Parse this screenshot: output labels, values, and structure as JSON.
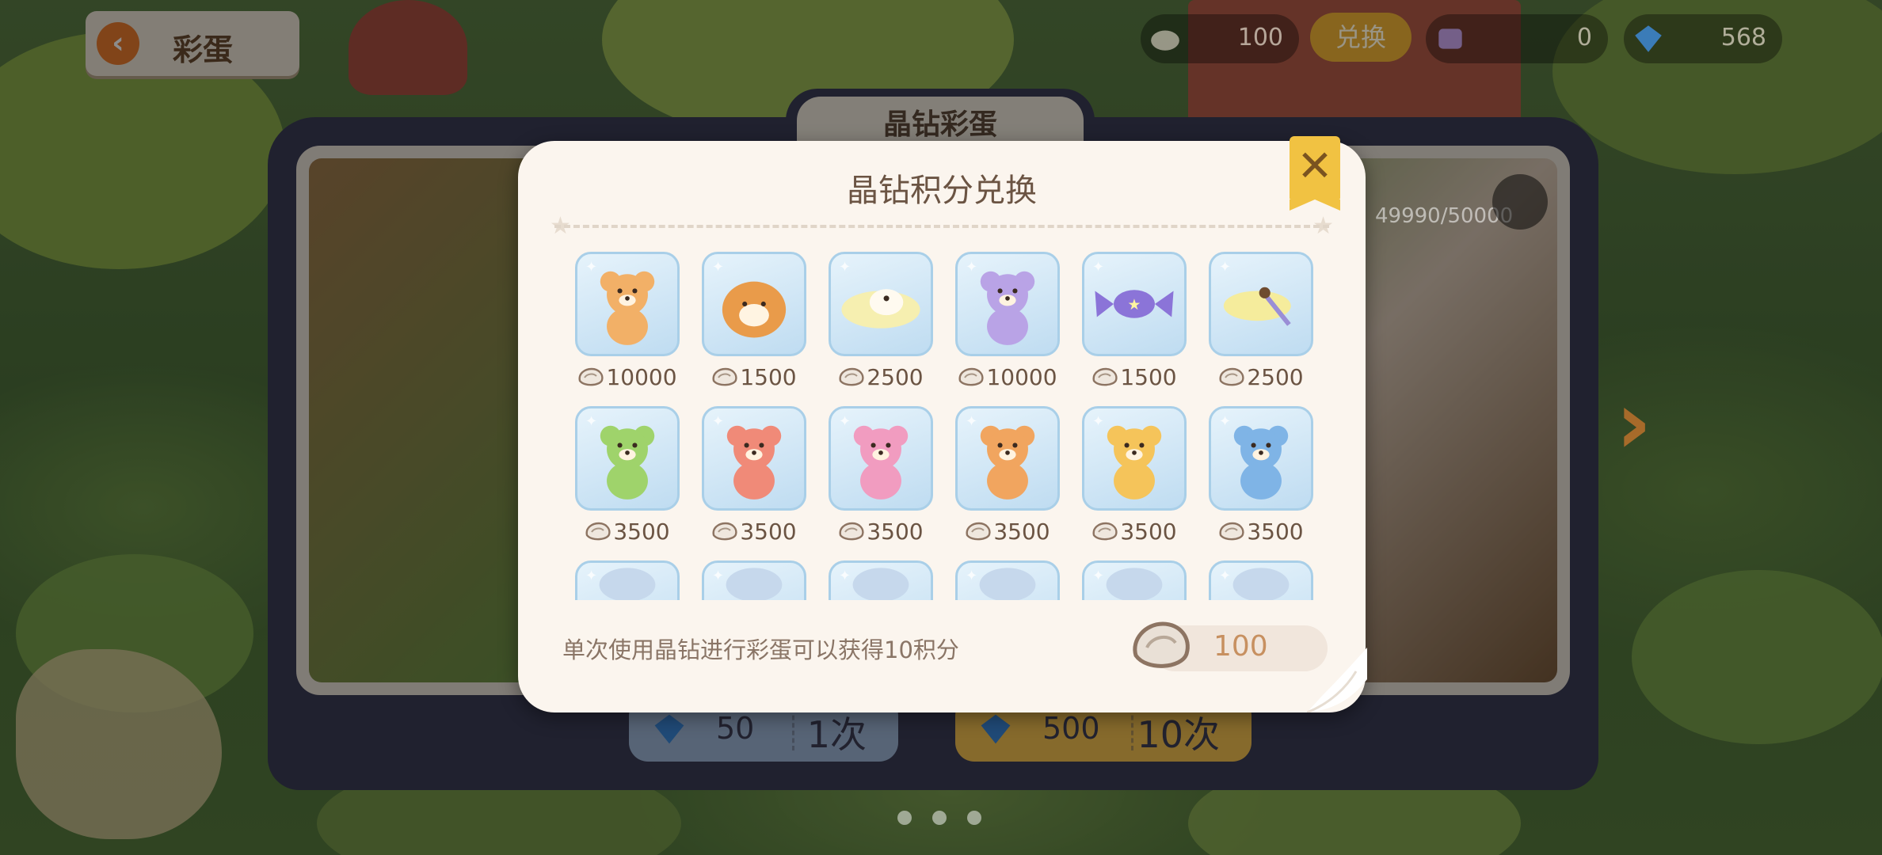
{
  "colors": {
    "modal_bg": "#fbf5ee",
    "tile_bg": "#cfe6f6",
    "accent_orange": "#ea7b2e",
    "accent_gold": "#f1c242",
    "text_brown": "#6b5443",
    "points_text": "#c79060"
  },
  "topbar": {
    "back_label": "彩蛋",
    "shell_count": "100",
    "exchange_label": "兑换",
    "ticket_count": "0",
    "gem_count": "568"
  },
  "panel": {
    "title": "晶钻彩蛋",
    "progress_text": "49990/50000",
    "single_draw": {
      "price": "50",
      "label": "1次"
    },
    "ten_draw": {
      "price": "500",
      "label": "10次"
    }
  },
  "modal": {
    "title": "晶钻积分兑换",
    "items": [
      {
        "icon": "orange-bear-costume-doll-icon",
        "cost": "10000"
      },
      {
        "icon": "fluffy-dog-plush-icon",
        "cost": "1500"
      },
      {
        "icon": "sleeping-puppy-pillow-icon",
        "cost": "2500"
      },
      {
        "icon": "purple-bear-costume-doll-icon",
        "cost": "10000"
      },
      {
        "icon": "purple-star-candy-icon",
        "cost": "1500"
      },
      {
        "icon": "moon-wand-icon",
        "cost": "2500"
      },
      {
        "icon": "green-teddy-bear-icon",
        "cost": "3500"
      },
      {
        "icon": "red-teddy-bear-icon",
        "cost": "3500"
      },
      {
        "icon": "pink-teddy-bear-icon",
        "cost": "3500"
      },
      {
        "icon": "orange-teddy-bear-icon",
        "cost": "3500"
      },
      {
        "icon": "yellow-teddy-bear-icon",
        "cost": "3500"
      },
      {
        "icon": "blue-teddy-bear-icon",
        "cost": "3500"
      },
      {
        "icon": "partially-visible-item-icon",
        "cost": ""
      },
      {
        "icon": "partially-visible-item-icon",
        "cost": ""
      },
      {
        "icon": "partially-visible-item-icon",
        "cost": ""
      },
      {
        "icon": "partially-visible-item-icon",
        "cost": ""
      },
      {
        "icon": "partially-visible-item-icon",
        "cost": ""
      },
      {
        "icon": "partially-visible-item-icon",
        "cost": ""
      }
    ],
    "footer_text": "单次使用晶钻进行彩蛋可以获得10积分",
    "points_value": "100"
  }
}
